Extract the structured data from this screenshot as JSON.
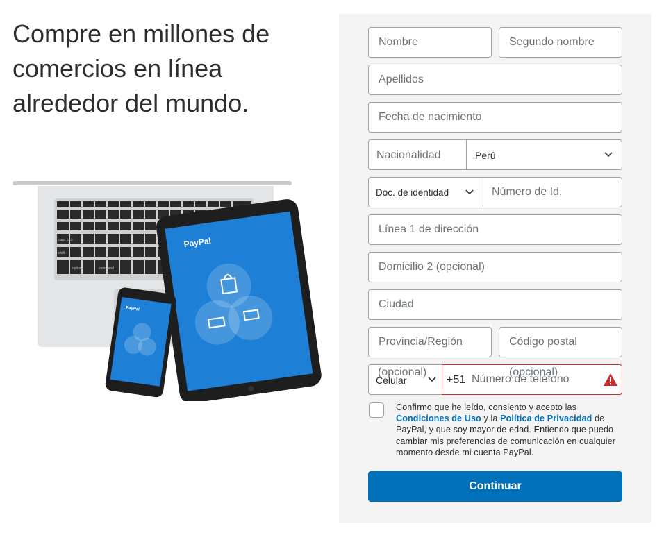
{
  "headline": "Compre en millones de comercios en línea alrededor del mundo.",
  "hero": {
    "laptop_keys": [
      "caps lock",
      "shift",
      "option",
      "command"
    ],
    "brand": "PayPal"
  },
  "form": {
    "first_name": {
      "placeholder": "Nombre"
    },
    "middle_name": {
      "placeholder": "Segundo nombre"
    },
    "last_name": {
      "placeholder": "Apellidos"
    },
    "birth_date": {
      "placeholder": "Fecha de nacimiento"
    },
    "nationality": {
      "label": "Nacionalidad",
      "value": "Perú"
    },
    "id_doc": {
      "type_value": "Doc. de identidad",
      "number_placeholder": "Número de Id."
    },
    "address1": {
      "placeholder": "Línea 1 de dirección"
    },
    "address2": {
      "placeholder": "Domicilio 2 (opcional)"
    },
    "city": {
      "placeholder": "Ciudad"
    },
    "state": {
      "placeholder": "Provincia/Región"
    },
    "postal": {
      "placeholder": "Código postal"
    },
    "phone": {
      "type_value": "Celular",
      "country_code": "+51",
      "placeholder": "Número de teléfono",
      "optional_hint_type": "(opcional)",
      "optional_hint_number": "(opcional)"
    },
    "consent": {
      "text_1": "Confirmo que he leído, consiento y acepto las",
      "terms_link": "Condiciones de Uso",
      "text_2": "y la",
      "privacy_link": "Política de Privacidad",
      "text_3": "de PayPal, y que soy mayor de edad. Entiendo que puedo cambiar mis preferencias de comunicación en cualquier momento desde mi cuenta PayPal."
    },
    "continue_label": "Continuar"
  },
  "colors": {
    "accent": "#0070ba",
    "panel_bg": "#f3f3f3",
    "error": "#c72e2e",
    "device_screen": "#1d7fd6"
  }
}
